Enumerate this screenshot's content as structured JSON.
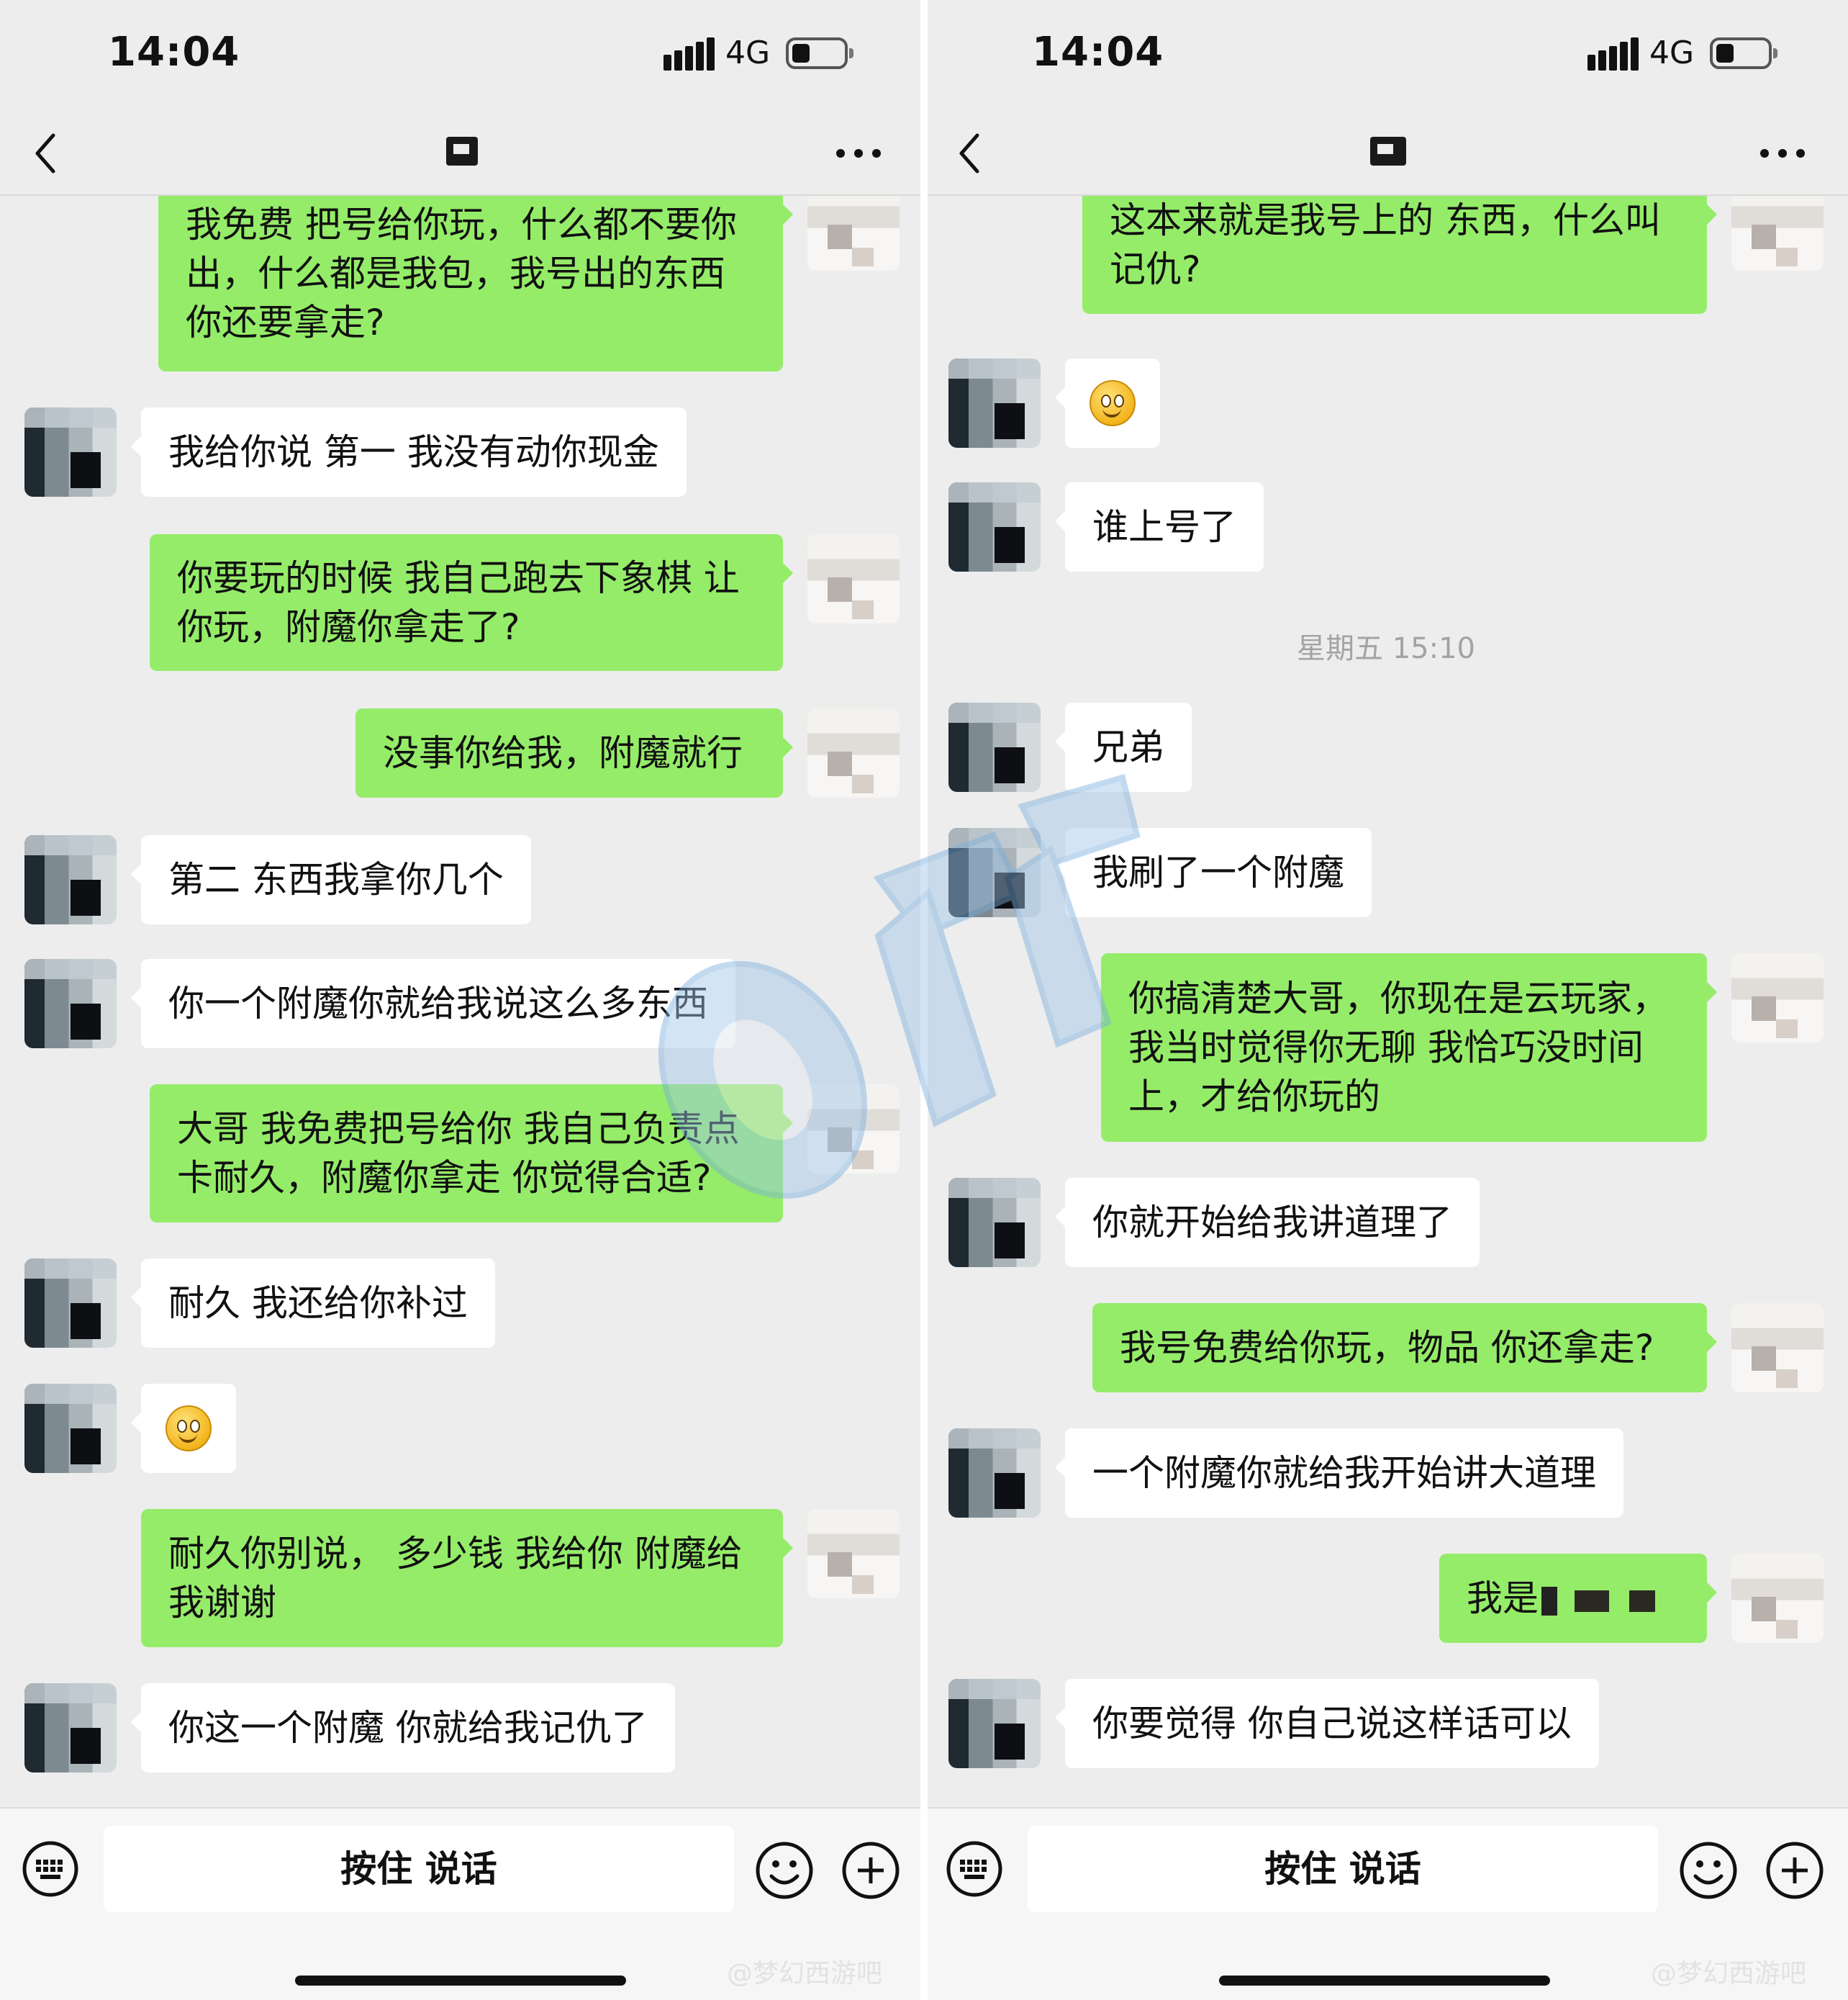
{
  "status": {
    "time": "14:04",
    "network": "4G"
  },
  "input": {
    "voice_label": "按住 说话"
  },
  "timestamp": "星期五 15:10",
  "weibo_watermark": "@梦幻西游吧",
  "left": {
    "messages": [
      {
        "text": "我免费 把号给你玩，什么都不要你出，什么都是我包，我号出的东西你还要拿走?"
      },
      {
        "text": "我给你说 第一  我没有动你现金"
      },
      {
        "text": "你要玩的时候 我自己跑去下象棋 让你玩，附魔你拿走了?"
      },
      {
        "text": "没事你给我，附魔就行"
      },
      {
        "text": "第二  东西我拿你几个"
      },
      {
        "text": "你一个附魔你就给我说这么多东西"
      },
      {
        "text": "大哥 我免费把号给你 我自己负责点卡耐久，附魔你拿走 你觉得合适?"
      },
      {
        "text": "耐久  我还给你补过"
      },
      {
        "text": ""
      },
      {
        "text": "耐久你别说， 多少钱 我给你 附魔给我谢谢"
      },
      {
        "text": "你这一个附魔  你就给我记仇了"
      }
    ]
  },
  "right": {
    "messages": [
      {
        "text": "这本来就是我号上的 东西，什么叫记仇?"
      },
      {
        "text": ""
      },
      {
        "text": "谁上号了"
      },
      {
        "text": "兄弟"
      },
      {
        "text": "我刷了一个附魔"
      },
      {
        "text": "你搞清楚大哥，你现在是云玩家，我当时觉得你无聊 我恰巧没时间上，才给你玩的"
      },
      {
        "text": "你就开始给我讲道理了"
      },
      {
        "text": "我号免费给你玩，物品 你还拿走?"
      },
      {
        "text": "一个附魔你就给我开始讲大道理"
      },
      {
        "text": "我是"
      },
      {
        "text": "你要觉得 你自己说这样话可以"
      }
    ]
  },
  "icons": {
    "back": "chevron-left-icon",
    "more": "more-dots-icon",
    "keyboard": "keyboard-icon",
    "emoji": "emoji-icon",
    "plus": "plus-icon",
    "smiley_sticker": "smiley-emoji"
  }
}
